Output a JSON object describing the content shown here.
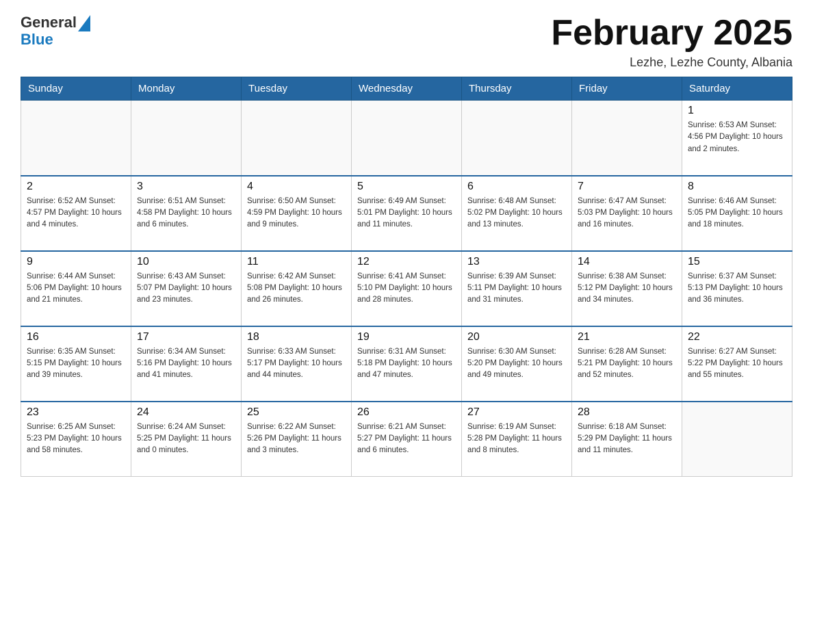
{
  "logo": {
    "general": "General",
    "blue": "Blue",
    "arrow_unicode": "▲"
  },
  "header": {
    "title": "February 2025",
    "subtitle": "Lezhe, Lezhe County, Albania"
  },
  "days_of_week": [
    "Sunday",
    "Monday",
    "Tuesday",
    "Wednesday",
    "Thursday",
    "Friday",
    "Saturday"
  ],
  "weeks": [
    [
      {
        "day": "",
        "info": ""
      },
      {
        "day": "",
        "info": ""
      },
      {
        "day": "",
        "info": ""
      },
      {
        "day": "",
        "info": ""
      },
      {
        "day": "",
        "info": ""
      },
      {
        "day": "",
        "info": ""
      },
      {
        "day": "1",
        "info": "Sunrise: 6:53 AM\nSunset: 4:56 PM\nDaylight: 10 hours and 2 minutes."
      }
    ],
    [
      {
        "day": "2",
        "info": "Sunrise: 6:52 AM\nSunset: 4:57 PM\nDaylight: 10 hours and 4 minutes."
      },
      {
        "day": "3",
        "info": "Sunrise: 6:51 AM\nSunset: 4:58 PM\nDaylight: 10 hours and 6 minutes."
      },
      {
        "day": "4",
        "info": "Sunrise: 6:50 AM\nSunset: 4:59 PM\nDaylight: 10 hours and 9 minutes."
      },
      {
        "day": "5",
        "info": "Sunrise: 6:49 AM\nSunset: 5:01 PM\nDaylight: 10 hours and 11 minutes."
      },
      {
        "day": "6",
        "info": "Sunrise: 6:48 AM\nSunset: 5:02 PM\nDaylight: 10 hours and 13 minutes."
      },
      {
        "day": "7",
        "info": "Sunrise: 6:47 AM\nSunset: 5:03 PM\nDaylight: 10 hours and 16 minutes."
      },
      {
        "day": "8",
        "info": "Sunrise: 6:46 AM\nSunset: 5:05 PM\nDaylight: 10 hours and 18 minutes."
      }
    ],
    [
      {
        "day": "9",
        "info": "Sunrise: 6:44 AM\nSunset: 5:06 PM\nDaylight: 10 hours and 21 minutes."
      },
      {
        "day": "10",
        "info": "Sunrise: 6:43 AM\nSunset: 5:07 PM\nDaylight: 10 hours and 23 minutes."
      },
      {
        "day": "11",
        "info": "Sunrise: 6:42 AM\nSunset: 5:08 PM\nDaylight: 10 hours and 26 minutes."
      },
      {
        "day": "12",
        "info": "Sunrise: 6:41 AM\nSunset: 5:10 PM\nDaylight: 10 hours and 28 minutes."
      },
      {
        "day": "13",
        "info": "Sunrise: 6:39 AM\nSunset: 5:11 PM\nDaylight: 10 hours and 31 minutes."
      },
      {
        "day": "14",
        "info": "Sunrise: 6:38 AM\nSunset: 5:12 PM\nDaylight: 10 hours and 34 minutes."
      },
      {
        "day": "15",
        "info": "Sunrise: 6:37 AM\nSunset: 5:13 PM\nDaylight: 10 hours and 36 minutes."
      }
    ],
    [
      {
        "day": "16",
        "info": "Sunrise: 6:35 AM\nSunset: 5:15 PM\nDaylight: 10 hours and 39 minutes."
      },
      {
        "day": "17",
        "info": "Sunrise: 6:34 AM\nSunset: 5:16 PM\nDaylight: 10 hours and 41 minutes."
      },
      {
        "day": "18",
        "info": "Sunrise: 6:33 AM\nSunset: 5:17 PM\nDaylight: 10 hours and 44 minutes."
      },
      {
        "day": "19",
        "info": "Sunrise: 6:31 AM\nSunset: 5:18 PM\nDaylight: 10 hours and 47 minutes."
      },
      {
        "day": "20",
        "info": "Sunrise: 6:30 AM\nSunset: 5:20 PM\nDaylight: 10 hours and 49 minutes."
      },
      {
        "day": "21",
        "info": "Sunrise: 6:28 AM\nSunset: 5:21 PM\nDaylight: 10 hours and 52 minutes."
      },
      {
        "day": "22",
        "info": "Sunrise: 6:27 AM\nSunset: 5:22 PM\nDaylight: 10 hours and 55 minutes."
      }
    ],
    [
      {
        "day": "23",
        "info": "Sunrise: 6:25 AM\nSunset: 5:23 PM\nDaylight: 10 hours and 58 minutes."
      },
      {
        "day": "24",
        "info": "Sunrise: 6:24 AM\nSunset: 5:25 PM\nDaylight: 11 hours and 0 minutes."
      },
      {
        "day": "25",
        "info": "Sunrise: 6:22 AM\nSunset: 5:26 PM\nDaylight: 11 hours and 3 minutes."
      },
      {
        "day": "26",
        "info": "Sunrise: 6:21 AM\nSunset: 5:27 PM\nDaylight: 11 hours and 6 minutes."
      },
      {
        "day": "27",
        "info": "Sunrise: 6:19 AM\nSunset: 5:28 PM\nDaylight: 11 hours and 8 minutes."
      },
      {
        "day": "28",
        "info": "Sunrise: 6:18 AM\nSunset: 5:29 PM\nDaylight: 11 hours and 11 minutes."
      },
      {
        "day": "",
        "info": ""
      }
    ]
  ]
}
